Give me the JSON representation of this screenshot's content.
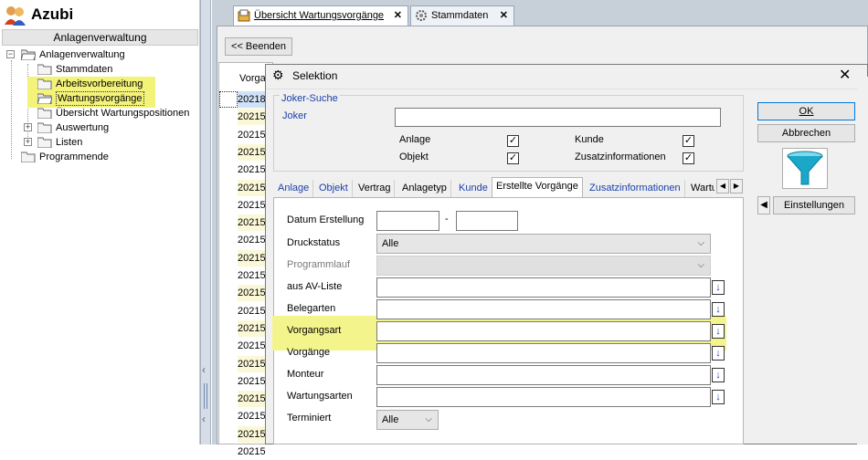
{
  "app": {
    "title": "Azubi",
    "section": "Anlagenverwaltung"
  },
  "tree": {
    "root": "Anlagenverwaltung",
    "items": [
      {
        "label": "Stammdaten"
      },
      {
        "label": "Arbeitsvorbereitung"
      },
      {
        "label": "Wartungsvorgänge"
      },
      {
        "label": "Übersicht Wartungspositionen"
      },
      {
        "label": "Auswertung"
      },
      {
        "label": "Listen"
      }
    ],
    "end": "Programmende"
  },
  "tabs": [
    {
      "label": "Übersicht Wartungsvorgänge",
      "close": "✕"
    },
    {
      "label": "Stammdaten",
      "close": "✕"
    }
  ],
  "toolbar": {
    "beenden": "<< Beenden"
  },
  "grid": {
    "header": "Vorga",
    "rows": [
      "20218",
      "20215",
      "20215",
      "20215",
      "20215",
      "20215",
      "20215",
      "20215",
      "20215",
      "20215",
      "20215",
      "20215",
      "20215",
      "20215",
      "20215",
      "20215",
      "20215",
      "20215",
      "20215",
      "20215",
      "20215"
    ]
  },
  "dialog": {
    "title": "Selektion",
    "close": "✕",
    "group_title": "Joker-Suche",
    "joker_label": "Joker",
    "joker_value": "",
    "checks": [
      {
        "label": "Anlage",
        "checked": true
      },
      {
        "label": "Kunde",
        "checked": true
      },
      {
        "label": "Objekt",
        "checked": true
      },
      {
        "label": "Zusatzinformationen",
        "checked": true
      }
    ],
    "tabs": [
      "Anlage",
      "Objekt",
      "Vertrag",
      "Anlagetyp",
      "Kunde",
      "Erstellte Vorgänge",
      "Zusatzinformationen",
      "Wartu"
    ],
    "fields": {
      "datum_label": "Datum Erstellung",
      "datum_sep": "-",
      "druckstatus_label": "Druckstatus",
      "druckstatus_value": "Alle",
      "programmlauf_label": "Programmlauf",
      "avliste_label": "aus AV-Liste",
      "belegarten_label": "Belegarten",
      "vorgangsart_label": "Vorgangsart",
      "vorgaenge_label": "Vorgänge",
      "monteur_label": "Monteur",
      "wartungsarten_label": "Wartungsarten",
      "terminiert_label": "Terminiert",
      "terminiert_value": "Alle"
    },
    "buttons": {
      "ok": "OK",
      "abbrechen": "Abbrechen",
      "einstellungen": "Einstellungen"
    }
  },
  "colors": {
    "highlight": "#f4f48c",
    "link_blue": "#1a3faa",
    "funnel": "#1aa7c9"
  }
}
